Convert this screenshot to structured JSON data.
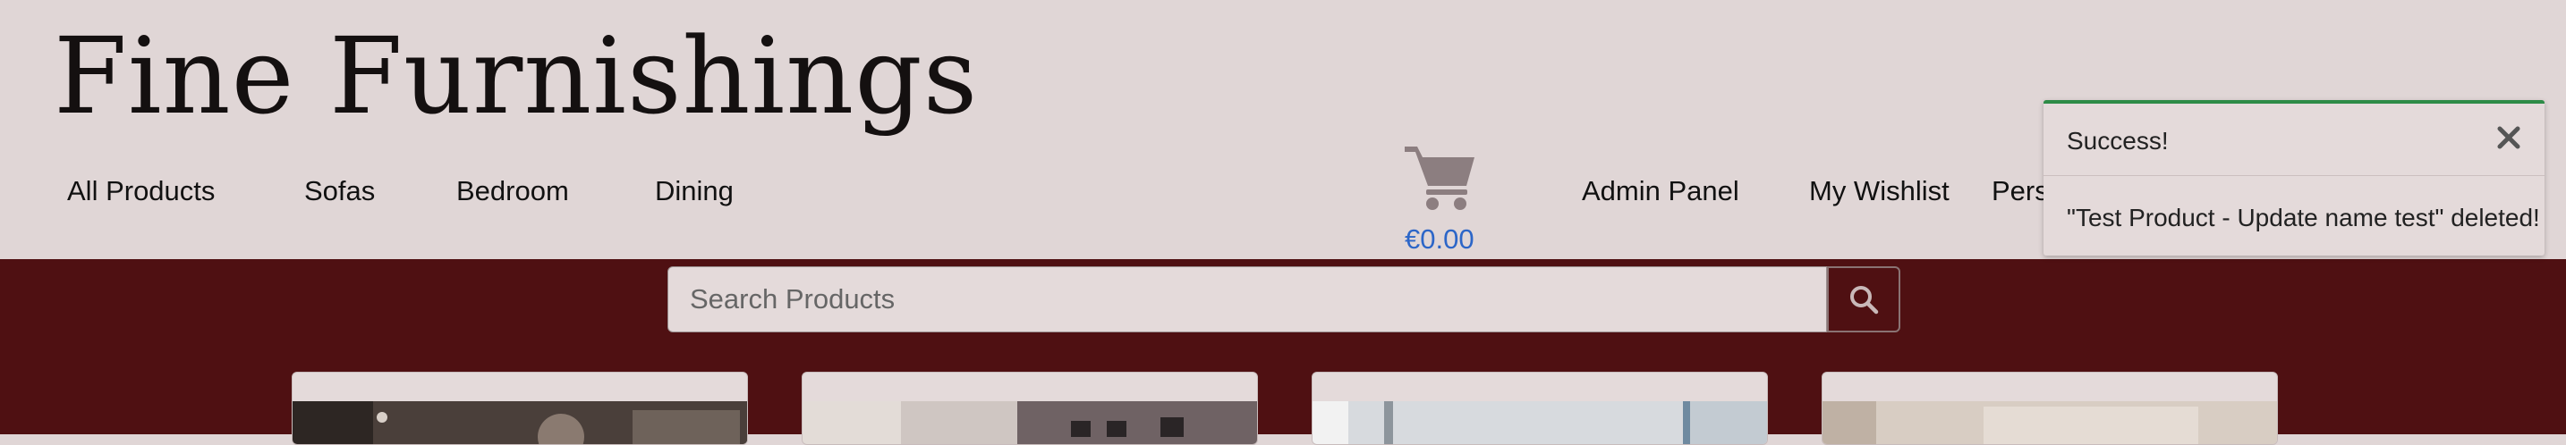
{
  "brand": {
    "title": "Fine Furnishings"
  },
  "nav": {
    "all_products": "All Products",
    "sofas": "Sofas",
    "bedroom": "Bedroom",
    "dining": "Dining",
    "admin_panel": "Admin Panel",
    "my_wishlist": "My Wishlist",
    "personal_truncated": "Pers"
  },
  "cart": {
    "icon": "cart-icon",
    "total": "€0.00"
  },
  "search": {
    "placeholder": "Search Products",
    "value": "",
    "icon": "search-icon"
  },
  "toast": {
    "title": "Success!",
    "message": "\"Test Product - Update name test\" deleted!",
    "close_icon": "close-icon"
  },
  "colors": {
    "header_bg": "#e0d6d6",
    "band_bg": "#4f1012",
    "accent_price": "#2c66c8",
    "toast_success": "#2e8b47"
  },
  "products": {
    "card_count_visible": 4
  }
}
